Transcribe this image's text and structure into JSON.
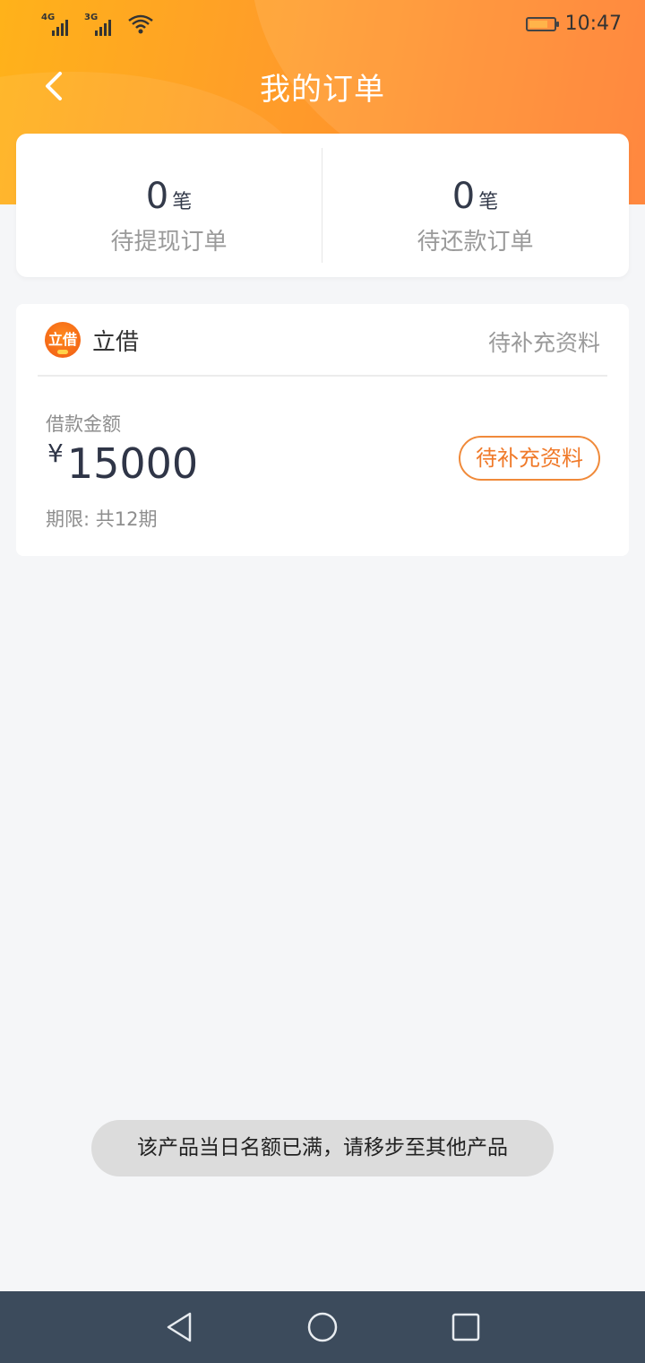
{
  "status_bar": {
    "signal1_tag": "4G",
    "signal2_tag": "3G",
    "time": "10:47",
    "icons": [
      "signal-icon",
      "wifi-icon",
      "battery-icon"
    ]
  },
  "header": {
    "title": "我的订单",
    "back_icon": "chevron-left-icon",
    "gradient_colors": [
      "#ffb21a",
      "#ff7a2a"
    ]
  },
  "summary": {
    "pending_withdraw": {
      "count": "0",
      "unit": "笔",
      "label": "待提现订单"
    },
    "pending_repay": {
      "count": "0",
      "unit": "笔",
      "label": "待还款订单"
    }
  },
  "order": {
    "logo_text": "立借",
    "product_name": "立借",
    "status": "待补充资料",
    "amount_label": "借款金额",
    "currency": "¥",
    "amount": "15000",
    "term": "期限: 共12期",
    "action_label": "待补充资料",
    "accent_color": "#f07a2a"
  },
  "toast": {
    "message": "该产品当日名额已满，请移步至其他产品"
  },
  "system_nav": {
    "icons": [
      "back-triangle-icon",
      "home-circle-icon",
      "recents-square-icon"
    ]
  }
}
